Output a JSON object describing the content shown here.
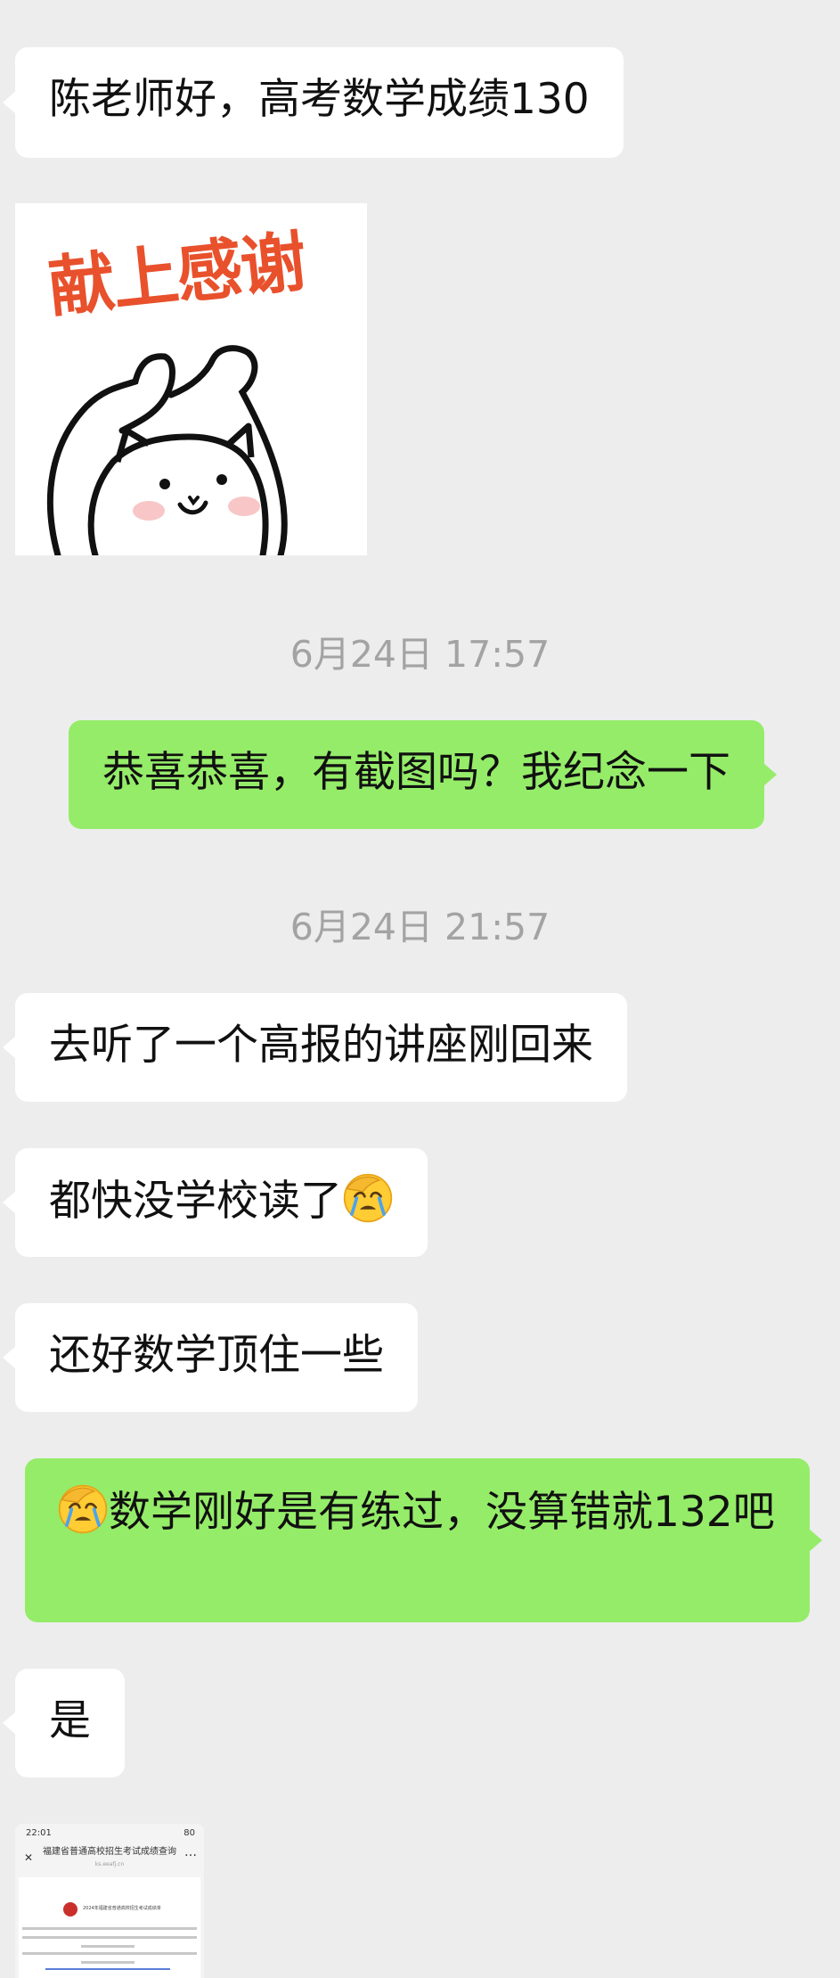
{
  "messages": [
    {
      "side": "in",
      "text": "陈老师好，高考数学成绩130"
    },
    {
      "side": "in",
      "type": "sticker",
      "text": "献上感谢"
    },
    {
      "type": "time",
      "text": "6月24日 17:57"
    },
    {
      "side": "out",
      "text": "恭喜恭喜，有截图吗？我纪念一下"
    },
    {
      "type": "time",
      "text": "6月24日 21:57"
    },
    {
      "side": "in",
      "text": "去听了一个高报的讲座刚回来"
    },
    {
      "side": "in",
      "text": "都快没学校读了",
      "trailing_icon": "facepalm-crying-emoji"
    },
    {
      "side": "in",
      "text": "还好数学顶住一些"
    },
    {
      "side": "out",
      "leading_icon": "facepalm-crying-emoji",
      "text": "数学刚好是有练过，没算错就132吧"
    },
    {
      "side": "in",
      "text": "是"
    },
    {
      "side": "in",
      "type": "image",
      "image": {
        "status_time": "22:01",
        "status_battery": "80",
        "page_title": "福建省普通高校招生考试成绩查询",
        "page_url": "ks.eeafj.cn",
        "doc_title": "2024年福建省普通高校招生考试成绩单"
      }
    }
  ],
  "colors": {
    "background": "#ededed",
    "incoming_bubble": "#ffffff",
    "outgoing_bubble": "#95ec69",
    "timestamp": "#a3a3a3",
    "sticker_text": "#e8512c"
  }
}
